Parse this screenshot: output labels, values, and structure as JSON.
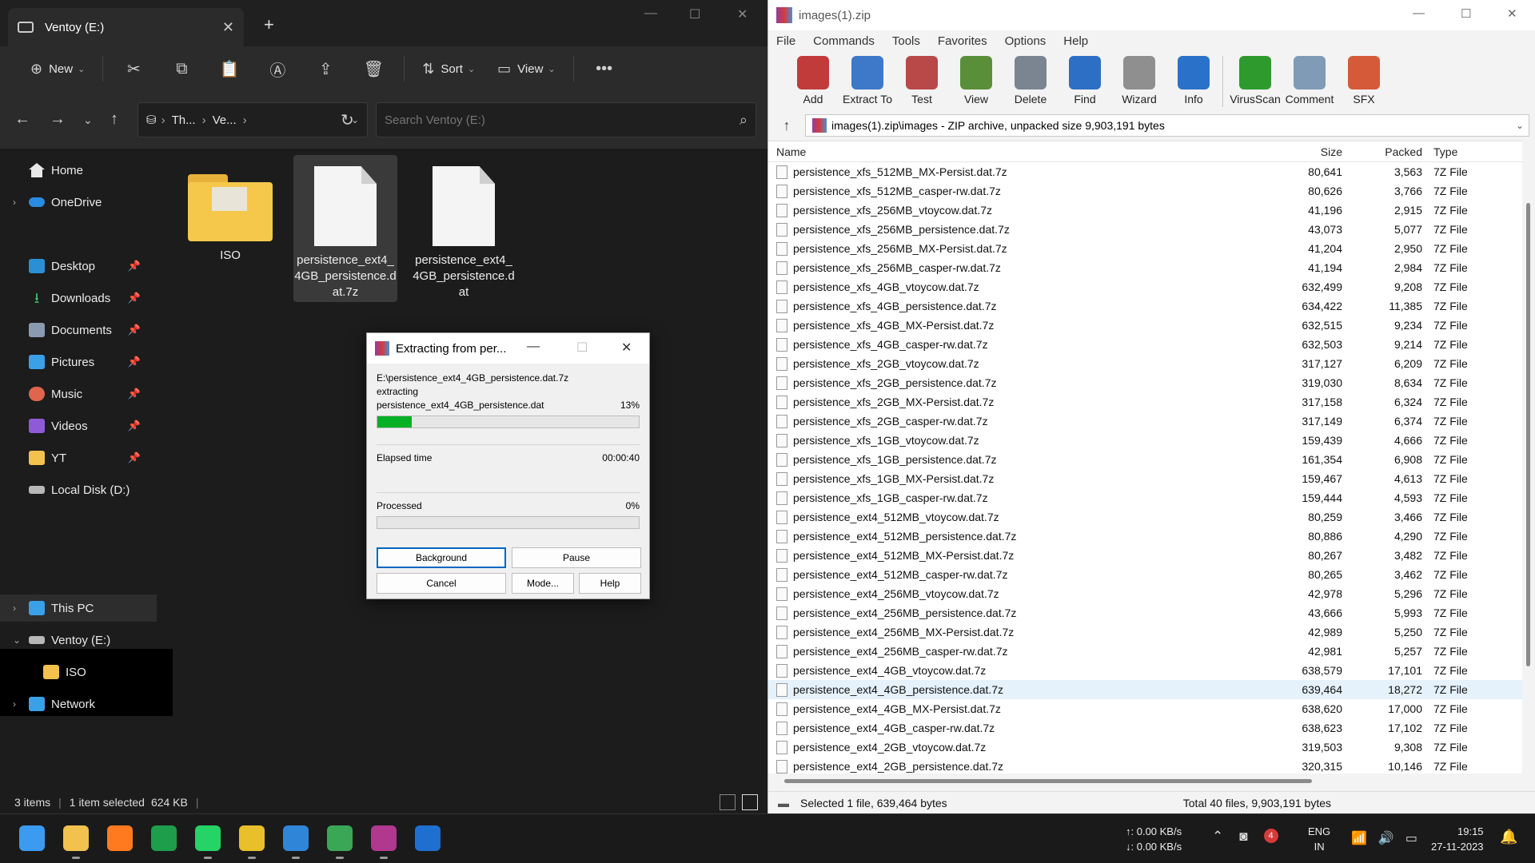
{
  "explorer": {
    "tab_title": "Ventoy (E:)",
    "toolbar": {
      "new_label": "New",
      "sort_label": "Sort",
      "view_label": "View"
    },
    "breadcrumb": [
      "Th...",
      "Ve..."
    ],
    "search_placeholder": "Search Ventoy (E:)",
    "sidebar": {
      "home": "Home",
      "onedrive": "OneDrive",
      "desktop": "Desktop",
      "downloads": "Downloads",
      "documents": "Documents",
      "pictures": "Pictures",
      "music": "Music",
      "videos": "Videos",
      "yt": "YT",
      "local_disk": "Local Disk (D:)",
      "this_pc": "This PC",
      "ventoy": "Ventoy (E:)",
      "iso": "ISO",
      "network": "Network"
    },
    "files": [
      {
        "name": "ISO",
        "kind": "folder"
      },
      {
        "name": "persistence_ext4_4GB_persistence.dat.7z",
        "kind": "file",
        "selected": true
      },
      {
        "name": "persistence_ext4_4GB_persistence.dat",
        "kind": "file"
      }
    ],
    "status": {
      "items": "3 items",
      "selection": "1 item selected",
      "size": "624 KB"
    }
  },
  "dialog": {
    "title": "Extracting from per...",
    "archive_path": "E:\\persistence_ext4_4GB_persistence.dat.7z",
    "action": "extracting",
    "current_file": "persistence_ext4_4GB_persistence.dat",
    "file_percent_label": "13%",
    "file_progress": 0.13,
    "elapsed_label": "Elapsed time",
    "elapsed_value": "00:00:40",
    "processed_label": "Processed",
    "processed_percent_label": "0%",
    "processed_progress": 0,
    "buttons": {
      "background": "Background",
      "pause": "Pause",
      "cancel": "Cancel",
      "mode": "Mode...",
      "help": "Help"
    }
  },
  "winrar": {
    "title": "images(1).zip",
    "menu": [
      "File",
      "Commands",
      "Tools",
      "Favorites",
      "Options",
      "Help"
    ],
    "tools": [
      {
        "label": "Add",
        "color": "#c23b3b"
      },
      {
        "label": "Extract To",
        "color": "#3d78c9"
      },
      {
        "label": "Test",
        "color": "#b94848"
      },
      {
        "label": "View",
        "color": "#5a8f3a"
      },
      {
        "label": "Delete",
        "color": "#7a8591"
      },
      {
        "label": "Find",
        "color": "#2d6fc4"
      },
      {
        "label": "Wizard",
        "color": "#8f8f8f"
      },
      {
        "label": "Info",
        "color": "#2a72c9"
      },
      {
        "label": "VirusScan",
        "color": "#2e9a2e"
      },
      {
        "label": "Comment",
        "color": "#7f9bb5"
      },
      {
        "label": "SFX",
        "color": "#d45a3a"
      }
    ],
    "path": "images(1).zip\\images - ZIP archive, unpacked size 9,903,191 bytes",
    "columns": {
      "name": "Name",
      "size": "Size",
      "packed": "Packed",
      "type": "Type"
    },
    "rows": [
      {
        "name": "persistence_xfs_512MB_MX-Persist.dat.7z",
        "size": "80,641",
        "packed": "3,563",
        "type": "7Z File"
      },
      {
        "name": "persistence_xfs_512MB_casper-rw.dat.7z",
        "size": "80,626",
        "packed": "3,766",
        "type": "7Z File"
      },
      {
        "name": "persistence_xfs_256MB_vtoycow.dat.7z",
        "size": "41,196",
        "packed": "2,915",
        "type": "7Z File"
      },
      {
        "name": "persistence_xfs_256MB_persistence.dat.7z",
        "size": "43,073",
        "packed": "5,077",
        "type": "7Z File"
      },
      {
        "name": "persistence_xfs_256MB_MX-Persist.dat.7z",
        "size": "41,204",
        "packed": "2,950",
        "type": "7Z File"
      },
      {
        "name": "persistence_xfs_256MB_casper-rw.dat.7z",
        "size": "41,194",
        "packed": "2,984",
        "type": "7Z File"
      },
      {
        "name": "persistence_xfs_4GB_vtoycow.dat.7z",
        "size": "632,499",
        "packed": "9,208",
        "type": "7Z File"
      },
      {
        "name": "persistence_xfs_4GB_persistence.dat.7z",
        "size": "634,422",
        "packed": "11,385",
        "type": "7Z File"
      },
      {
        "name": "persistence_xfs_4GB_MX-Persist.dat.7z",
        "size": "632,515",
        "packed": "9,234",
        "type": "7Z File"
      },
      {
        "name": "persistence_xfs_4GB_casper-rw.dat.7z",
        "size": "632,503",
        "packed": "9,214",
        "type": "7Z File"
      },
      {
        "name": "persistence_xfs_2GB_vtoycow.dat.7z",
        "size": "317,127",
        "packed": "6,209",
        "type": "7Z File"
      },
      {
        "name": "persistence_xfs_2GB_persistence.dat.7z",
        "size": "319,030",
        "packed": "8,634",
        "type": "7Z File"
      },
      {
        "name": "persistence_xfs_2GB_MX-Persist.dat.7z",
        "size": "317,158",
        "packed": "6,324",
        "type": "7Z File"
      },
      {
        "name": "persistence_xfs_2GB_casper-rw.dat.7z",
        "size": "317,149",
        "packed": "6,374",
        "type": "7Z File"
      },
      {
        "name": "persistence_xfs_1GB_vtoycow.dat.7z",
        "size": "159,439",
        "packed": "4,666",
        "type": "7Z File"
      },
      {
        "name": "persistence_xfs_1GB_persistence.dat.7z",
        "size": "161,354",
        "packed": "6,908",
        "type": "7Z File"
      },
      {
        "name": "persistence_xfs_1GB_MX-Persist.dat.7z",
        "size": "159,467",
        "packed": "4,613",
        "type": "7Z File"
      },
      {
        "name": "persistence_xfs_1GB_casper-rw.dat.7z",
        "size": "159,444",
        "packed": "4,593",
        "type": "7Z File"
      },
      {
        "name": "persistence_ext4_512MB_vtoycow.dat.7z",
        "size": "80,259",
        "packed": "3,466",
        "type": "7Z File"
      },
      {
        "name": "persistence_ext4_512MB_persistence.dat.7z",
        "size": "80,886",
        "packed": "4,290",
        "type": "7Z File"
      },
      {
        "name": "persistence_ext4_512MB_MX-Persist.dat.7z",
        "size": "80,267",
        "packed": "3,482",
        "type": "7Z File"
      },
      {
        "name": "persistence_ext4_512MB_casper-rw.dat.7z",
        "size": "80,265",
        "packed": "3,462",
        "type": "7Z File"
      },
      {
        "name": "persistence_ext4_256MB_vtoycow.dat.7z",
        "size": "42,978",
        "packed": "5,296",
        "type": "7Z File"
      },
      {
        "name": "persistence_ext4_256MB_persistence.dat.7z",
        "size": "43,666",
        "packed": "5,993",
        "type": "7Z File"
      },
      {
        "name": "persistence_ext4_256MB_MX-Persist.dat.7z",
        "size": "42,989",
        "packed": "5,250",
        "type": "7Z File"
      },
      {
        "name": "persistence_ext4_256MB_casper-rw.dat.7z",
        "size": "42,981",
        "packed": "5,257",
        "type": "7Z File"
      },
      {
        "name": "persistence_ext4_4GB_vtoycow.dat.7z",
        "size": "638,579",
        "packed": "17,101",
        "type": "7Z File"
      },
      {
        "name": "persistence_ext4_4GB_persistence.dat.7z",
        "size": "639,464",
        "packed": "18,272",
        "type": "7Z File",
        "selected": true
      },
      {
        "name": "persistence_ext4_4GB_MX-Persist.dat.7z",
        "size": "638,620",
        "packed": "17,000",
        "type": "7Z File"
      },
      {
        "name": "persistence_ext4_4GB_casper-rw.dat.7z",
        "size": "638,623",
        "packed": "17,102",
        "type": "7Z File"
      },
      {
        "name": "persistence_ext4_2GB_vtoycow.dat.7z",
        "size": "319,503",
        "packed": "9,308",
        "type": "7Z File"
      },
      {
        "name": "persistence_ext4_2GB_persistence.dat.7z",
        "size": "320,315",
        "packed": "10,146",
        "type": "7Z File"
      }
    ],
    "status_left": "Selected 1 file, 639,464 bytes",
    "status_right": "Total 40 files, 9,903,191 bytes"
  },
  "taskbar": {
    "upload": "↑: 0.00 KB/s",
    "download": "↓: 0.00 KB/s",
    "badge": "4",
    "lang": "ENG",
    "region": "IN",
    "time": "19:15",
    "date": "27-11-2023",
    "apps": [
      {
        "name": "start",
        "color": "#3a9bf0"
      },
      {
        "name": "file-explorer",
        "color": "#f2c14e",
        "state": "running"
      },
      {
        "name": "firefox",
        "color": "#ff7a1f",
        "state": "active"
      },
      {
        "name": "sheets",
        "color": "#1e9e4a"
      },
      {
        "name": "whatsapp",
        "color": "#25d366",
        "state": "running"
      },
      {
        "name": "pdf",
        "color": "#e9c02a",
        "state": "running"
      },
      {
        "name": "paint",
        "color": "#2f86d8",
        "state": "running"
      },
      {
        "name": "chrome",
        "color": "#3aa757",
        "state": "running"
      },
      {
        "name": "winrar",
        "color": "#b0388f",
        "state": "running"
      },
      {
        "name": "defender",
        "color": "#1f6fd1"
      }
    ]
  }
}
